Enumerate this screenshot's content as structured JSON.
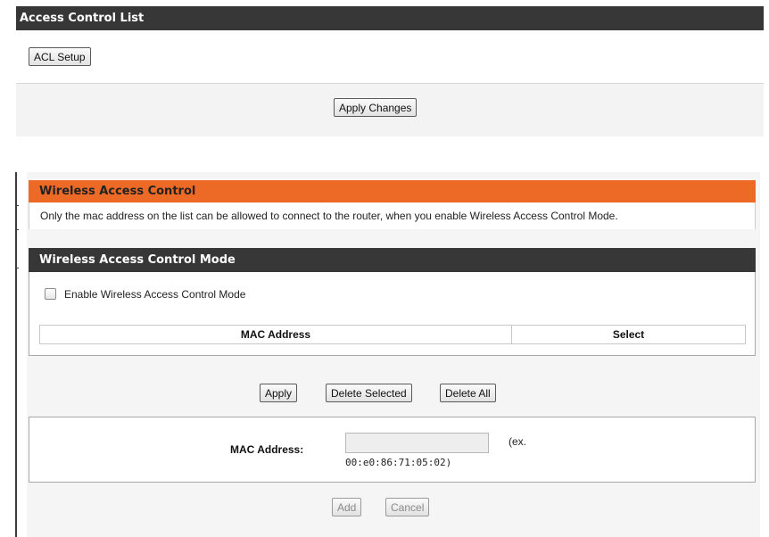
{
  "acl": {
    "title": "Access Control List",
    "setup_button": "ACL Setup",
    "apply_changes_button": "Apply Changes"
  },
  "wireless_access_control": {
    "title": "Wireless Access Control",
    "description": "Only the mac address on the list can be allowed to connect to the router, when you enable Wireless Access Control Mode."
  },
  "mode": {
    "title": "Wireless Access Control Mode",
    "enable_label": "Enable Wireless Access Control Mode",
    "enable_checked": false,
    "table_headers": [
      "MAC Address",
      "Select"
    ],
    "table_rows": []
  },
  "actions": {
    "apply": "Apply",
    "delete_selected": "Delete Selected",
    "delete_all": "Delete All"
  },
  "add_form": {
    "mac_label": "MAC Address:",
    "mac_value": "",
    "hint_prefix": "(ex.",
    "hint_example": "00:e0:86:71:05:02)",
    "add_button": "Add",
    "cancel_button": "Cancel"
  },
  "colors": {
    "header_dark": "#373737",
    "header_orange": "#ed6a26"
  }
}
